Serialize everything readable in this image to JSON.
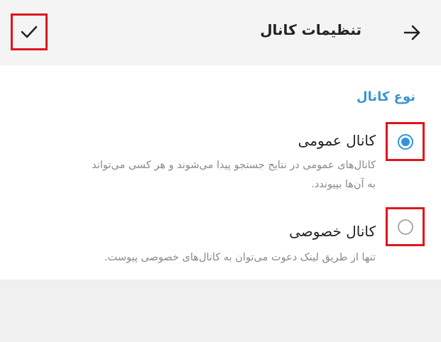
{
  "header": {
    "title": "تنظیمات کانال",
    "back_icon": "arrow-right-icon",
    "confirm_icon": "checkmark-icon"
  },
  "channel_type": {
    "section_title": "نوع کانال",
    "accent_color": "#3a95d0",
    "options": [
      {
        "title": "کانال عمومی",
        "description_line1": "کانال‌های عمومی در نتایج جستجو پیدا می‌شوند و هر کسی می‌تواند",
        "description_line2": "به آن‌ها بپیوندد.",
        "selected": true
      },
      {
        "title": "کانال خصوصی",
        "description_line1": "تنها از طریق لینک دعوت می‌توان به کانال‌های خصوصی پیوست.",
        "selected": false
      }
    ]
  },
  "highlight_color": "#e0141c"
}
